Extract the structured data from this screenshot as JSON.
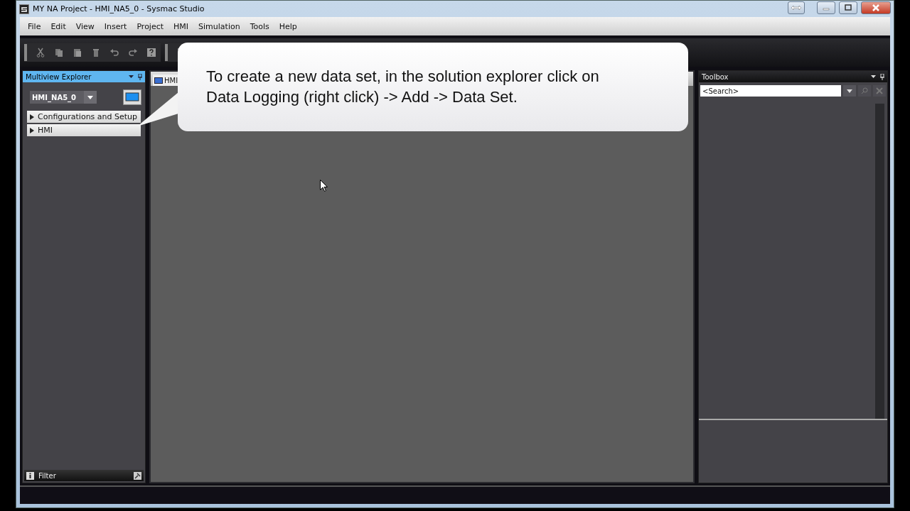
{
  "window": {
    "title": "MY NA Project - HMI_NA5_0 - Sysmac Studio"
  },
  "menu": [
    "File",
    "Edit",
    "View",
    "Insert",
    "Project",
    "HMI",
    "Simulation",
    "Tools",
    "Help"
  ],
  "explorer": {
    "title": "Multiview Explorer",
    "device": "HMI_NA5_0",
    "items": [
      {
        "label": "Configurations and Setup",
        "expanded": false
      },
      {
        "label": "HMI",
        "expanded": false
      }
    ],
    "filter": "Filter"
  },
  "editor": {
    "tab": "HMI"
  },
  "toolbox": {
    "title": "Toolbox",
    "search": {
      "placeholder": "<Search>"
    }
  },
  "callout": {
    "lines": [
      "To create a new data set, in the solution explorer click on",
      "Data Logging (right click) -> Add -> Data Set."
    ]
  }
}
